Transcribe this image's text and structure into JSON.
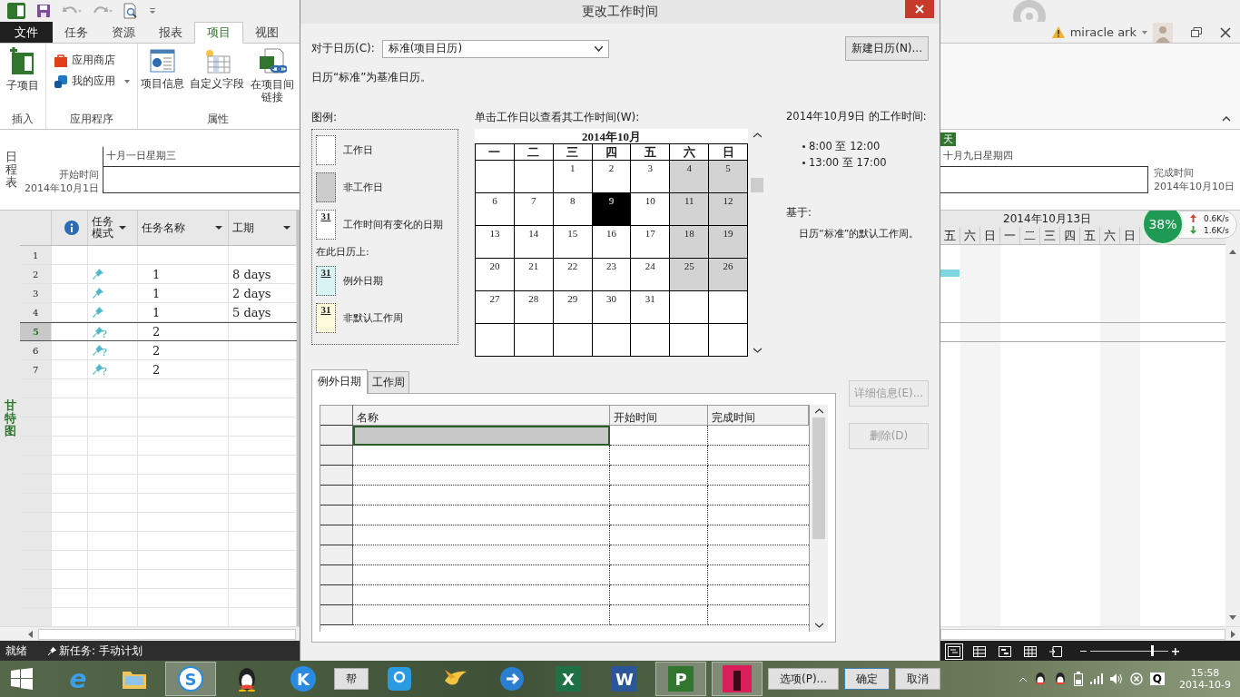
{
  "app": {
    "ribbon_tabs": [
      {
        "label": "文件",
        "kind": "file",
        "selected": false
      },
      {
        "label": "任务",
        "kind": "tab",
        "selected": false
      },
      {
        "label": "资源",
        "kind": "tab",
        "selected": false
      },
      {
        "label": "报表",
        "kind": "tab",
        "selected": false
      },
      {
        "label": "项目",
        "kind": "tab",
        "selected": true
      },
      {
        "label": "视图",
        "kind": "tab",
        "selected": false
      }
    ],
    "ribbon_groups": [
      {
        "label": "插入",
        "kind": "large",
        "buttons": [
          {
            "label": "子项目",
            "kind": "subproject"
          }
        ]
      },
      {
        "label": "应用程序",
        "kind": "small",
        "buttons": [
          {
            "label": "应用商店",
            "kind": "store"
          },
          {
            "label": "我的应用",
            "kind": "myapps"
          }
        ]
      },
      {
        "label": "属性",
        "kind": "large",
        "buttons": [
          {
            "label": "项目信息",
            "kind": "info"
          },
          {
            "label": "自定义字段",
            "kind": "fields"
          },
          {
            "label": "在项目间链接",
            "kind": "link"
          }
        ]
      }
    ],
    "account": {
      "user": "miracle ark"
    },
    "timeline": {
      "side_label": "日程表",
      "start_label": "开始时间",
      "start_date": "2014年10月1日",
      "left_date": "十月一日星期三",
      "today_marker": "天",
      "right_date": "十月九日星期四",
      "finish_label": "完成时间",
      "finish_date": "2014年10月10日"
    },
    "view_label": "甘特图",
    "task_table": {
      "columns": [
        {
          "label": "任务模式",
          "kind": "mode"
        },
        {
          "label": "任务名称",
          "kind": "name"
        },
        {
          "label": "工期",
          "kind": "duration"
        }
      ],
      "rows": [
        {
          "id": "1",
          "selected": false
        },
        {
          "id": "2",
          "kind": "manual",
          "name": "1",
          "duration": "8 days",
          "selected": false
        },
        {
          "id": "3",
          "kind": "manual",
          "name": "1",
          "duration": "2 days",
          "selected": false
        },
        {
          "id": "4",
          "kind": "manual",
          "name": "1",
          "duration": "5 days",
          "selected": false
        },
        {
          "id": "5",
          "kind": "unknown",
          "mode_mark": "?",
          "name": "2",
          "selected": true
        },
        {
          "id": "6",
          "kind": "unknown",
          "mode_mark": "?",
          "name": "2",
          "selected": false
        },
        {
          "id": "7",
          "kind": "unknown",
          "mode_mark": "?",
          "name": "2",
          "selected": false
        }
      ]
    },
    "gantt": {
      "week_label": "2014年10月13日",
      "days": [
        "五",
        "六",
        "日",
        "一",
        "二",
        "三",
        "四",
        "五",
        "六",
        "日"
      ]
    },
    "net_monitor": {
      "percent": "38%",
      "up": "0.6K/s",
      "down": "1.6K/s"
    },
    "status_bar": {
      "ready": "就绪",
      "new_task": "新任务: 手动计划",
      "zoom": {
        "level": 0.78
      }
    }
  },
  "dialog": {
    "title": "更改工作时间",
    "for_calendar_label": "对于日历(C):",
    "calendar_value": "标准(项目日历)",
    "new_calendar_button": "新建日历(N)...",
    "base_note": "日历“标准”为基准日历。",
    "legend": {
      "title": "图例:",
      "items": [
        {
          "kind": "working",
          "label": "工作日"
        },
        {
          "kind": "nonworking",
          "label": "非工作日"
        },
        {
          "kind": "changed",
          "day": "31",
          "label": "工作时间有变化的日期"
        }
      ],
      "on_calendar_label": "在此日历上:",
      "calendar_items": [
        {
          "kind": "exception",
          "day": "31",
          "label": "例外日期"
        },
        {
          "kind": "nondefault",
          "day": "31",
          "label": "非默认工作周"
        }
      ]
    },
    "calendar": {
      "prompt": "单击工作日以查看其工作时间(W):",
      "month": "2014年10月",
      "weekdays": [
        "一",
        "二",
        "三",
        "四",
        "五",
        "六",
        "日"
      ],
      "weeks": [
        [
          {
            "nonworking": false,
            "selected": false
          },
          {
            "nonworking": false,
            "selected": false
          },
          {
            "day": "1",
            "nonworking": false,
            "selected": false
          },
          {
            "day": "2",
            "nonworking": false,
            "selected": false
          },
          {
            "day": "3",
            "nonworking": false,
            "selected": false
          },
          {
            "day": "4",
            "nonworking": true,
            "selected": false
          },
          {
            "day": "5",
            "nonworking": true,
            "selected": false
          }
        ],
        [
          {
            "day": "6",
            "nonworking": false,
            "selected": false
          },
          {
            "day": "7",
            "nonworking": false,
            "selected": false
          },
          {
            "day": "8",
            "nonworking": false,
            "selected": false
          },
          {
            "day": "9",
            "nonworking": false,
            "selected": true
          },
          {
            "day": "10",
            "nonworking": false,
            "selected": false
          },
          {
            "day": "11",
            "nonworking": true,
            "selected": false
          },
          {
            "day": "12",
            "nonworking": true,
            "selected": false
          }
        ],
        [
          {
            "day": "13",
            "nonworking": false,
            "selected": false
          },
          {
            "day": "14",
            "nonworking": false,
            "selected": false
          },
          {
            "day": "15",
            "nonworking": false,
            "selected": false
          },
          {
            "day": "16",
            "nonworking": false,
            "selected": false
          },
          {
            "day": "17",
            "nonworking": false,
            "selected": false
          },
          {
            "day": "18",
            "nonworking": true,
            "selected": false
          },
          {
            "day": "19",
            "nonworking": true,
            "selected": false
          }
        ],
        [
          {
            "day": "20",
            "nonworking": false,
            "selected": false
          },
          {
            "day": "21",
            "nonworking": false,
            "selected": false
          },
          {
            "day": "22",
            "nonworking": false,
            "selected": false
          },
          {
            "day": "23",
            "nonworking": false,
            "selected": false
          },
          {
            "day": "24",
            "nonworking": false,
            "selected": false
          },
          {
            "day": "25",
            "nonworking": true,
            "selected": false
          },
          {
            "day": "26",
            "nonworking": true,
            "selected": false
          }
        ],
        [
          {
            "day": "27",
            "nonworking": false,
            "selected": false
          },
          {
            "day": "28",
            "nonworking": false,
            "selected": false
          },
          {
            "day": "29",
            "nonworking": false,
            "selected": false
          },
          {
            "day": "30",
            "nonworking": false,
            "selected": false
          },
          {
            "day": "31",
            "nonworking": false,
            "selected": false
          },
          {
            "nonworking": false,
            "selected": false
          },
          {
            "nonworking": false,
            "selected": false
          }
        ],
        [
          {
            "nonworking": false,
            "selected": false
          },
          {
            "nonworking": false,
            "selected": false
          },
          {
            "nonworking": false,
            "selected": false
          },
          {
            "nonworking": false,
            "selected": false
          },
          {
            "nonworking": false,
            "selected": false
          },
          {
            "nonworking": false,
            "selected": false
          },
          {
            "nonworking": false,
            "selected": false
          }
        ]
      ]
    },
    "working_times": {
      "title": "2014年10月9日 的工作时间:",
      "times": [
        "8:00 至 12:00",
        "13:00 至 17:00"
      ],
      "based_on_label": "基于:",
      "based_on": "日历“标准”的默认工作周。"
    },
    "tabs": [
      {
        "label": "例外日期",
        "selected": true
      },
      {
        "label": "工作周",
        "selected": false
      }
    ],
    "exceptions": {
      "columns": [
        "名称",
        "开始时间",
        "完成时间"
      ],
      "rows": [
        {
          "selected": true
        },
        {
          "selected": false
        },
        {
          "selected": false
        },
        {
          "selected": false
        },
        {
          "selected": false
        },
        {
          "selected": false
        },
        {
          "selected": false
        },
        {
          "selected": false
        },
        {
          "selected": false
        },
        {
          "selected": false
        }
      ]
    },
    "side_buttons": [
      {
        "label": "详细信息(E)...",
        "disabled": true
      },
      {
        "label": "删除(D)",
        "disabled": true
      }
    ],
    "footer_buttons": [
      {
        "label": "帮",
        "kind": "help"
      },
      {
        "label": "选项(P)...",
        "kind": "options"
      },
      {
        "label": "确定",
        "kind": "ok"
      },
      {
        "label": "取消",
        "kind": "cancel"
      }
    ]
  },
  "taskbar": {
    "apps": [
      {
        "kind": "browser",
        "glyph": "e",
        "selected": false
      },
      {
        "kind": "folder",
        "selected": false
      },
      {
        "kind": "input",
        "glyph": "S",
        "selected": true
      },
      {
        "kind": "penguin",
        "selected": false
      },
      {
        "kind": "player",
        "glyph": "K",
        "selected": false
      },
      {
        "kind": "bluesquare",
        "selected": false
      },
      {
        "kind": "bird",
        "selected": false
      },
      {
        "kind": "bluecircle",
        "selected": false
      },
      {
        "kind": "excel",
        "glyph": "X",
        "selected": false
      },
      {
        "kind": "word",
        "glyph": "W",
        "selected": false
      },
      {
        "kind": "project",
        "glyph": "P",
        "selected": true
      },
      {
        "kind": "photo",
        "selected": true
      }
    ],
    "tray_key": "Q",
    "time": "15:58",
    "date": "2014-10-9"
  }
}
